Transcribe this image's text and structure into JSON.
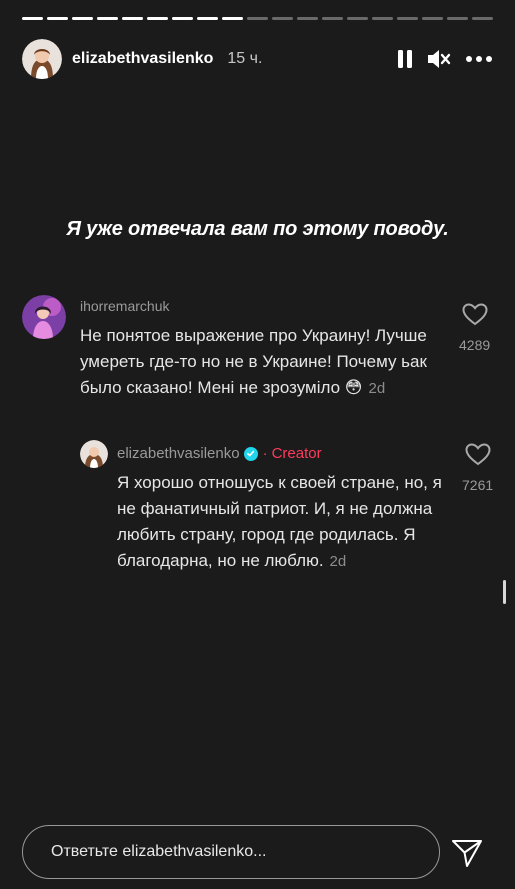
{
  "story": {
    "progress_segments_total": 19,
    "progress_segments_done": 9,
    "username": "elizabethvasilenko",
    "time_ago": "15 ч.",
    "caption": "Я уже отвечала вам по этому поводу."
  },
  "comment": {
    "username": "ihorremarchuk",
    "text": "Не понятое выражение про Украину! Лучше умереть где-то но не в Украине! Почему ьак было сказано! Мені не зрозуміло 😳",
    "date": "2d",
    "likes": "4289"
  },
  "reply": {
    "username": "elizabethvasilenko",
    "dot": "·",
    "badge": "Creator",
    "text": "Я хорошо отношусь к своей стране, но, я не фанатичный патриот. И, я не должна любить страну, город где родилась. Я благодарна, но не люблю.",
    "date": "2d",
    "likes": "7261"
  },
  "footer": {
    "placeholder": "Ответьте elizabethvasilenko..."
  },
  "colors": {
    "background": "#1b1b1b",
    "creator_accent": "#ff3b5c",
    "verified": "#20d5ec"
  },
  "icons": [
    "pause-icon",
    "mute-icon",
    "more-icon",
    "heart-icon",
    "verified-icon",
    "send-icon"
  ]
}
